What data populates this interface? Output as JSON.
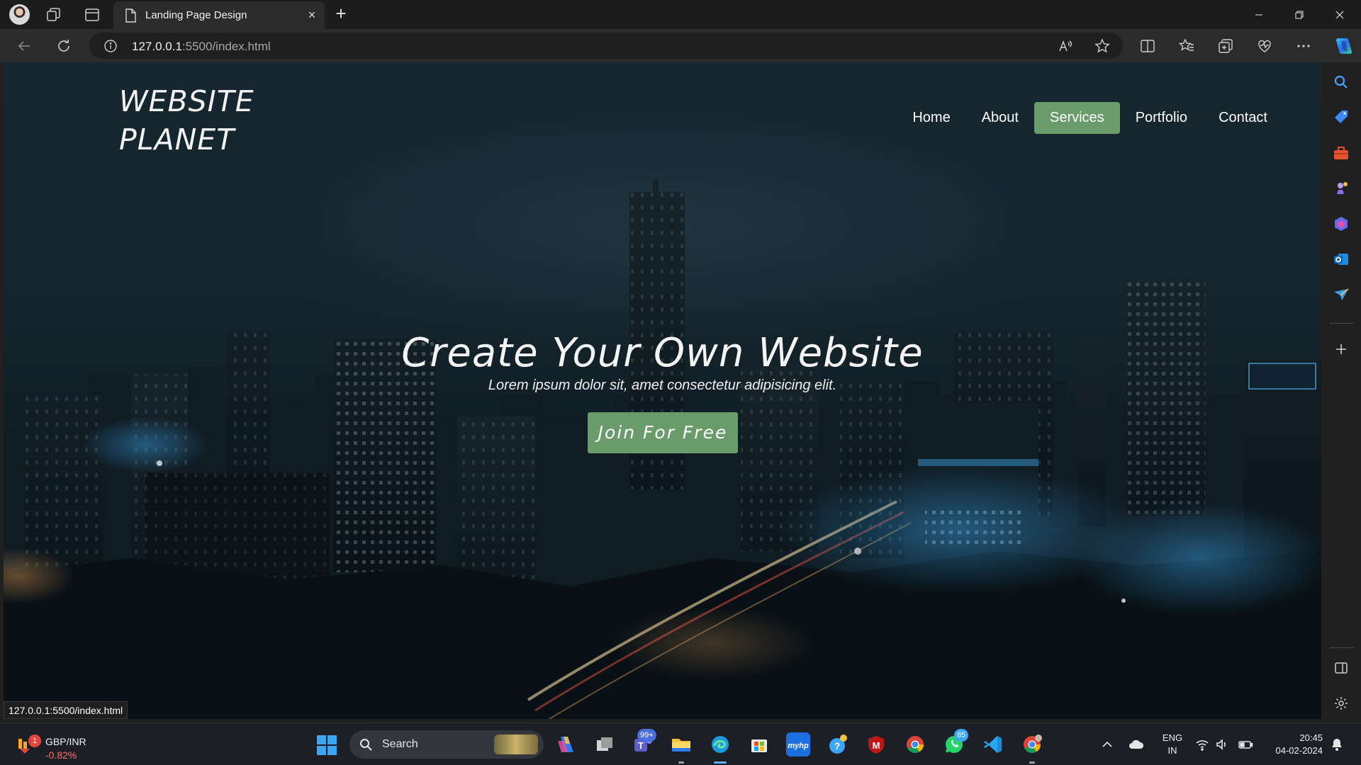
{
  "browser": {
    "tab_title": "Landing Page Design",
    "url_host": "127.0.0.1",
    "url_rest": ":5500/index.html",
    "status_url": "127.0.0.1:5500/index.html"
  },
  "page": {
    "logo": [
      "WEBSITE",
      "PLANET"
    ],
    "nav": [
      "Home",
      "About",
      "Services",
      "Portfolio",
      "Contact"
    ],
    "active_nav": "Services",
    "hero_title": "Create Your Own Website",
    "hero_subtitle": "Lorem ipsum dolor sit, amet consectetur adipisicing elit.",
    "cta_label": "Join For Free",
    "accent_color": "#6a9b6b"
  },
  "taskbar": {
    "ticker_name": "GBP/INR",
    "ticker_change": "-0.82%",
    "ticker_badge": "1",
    "search_label": "Search",
    "teams_badge": "99+",
    "whatsapp_badge": "85",
    "mcafee_label": "M",
    "lang_line1": "ENG",
    "lang_line2": "IN",
    "time": "20:45",
    "date": "04-02-2024"
  }
}
